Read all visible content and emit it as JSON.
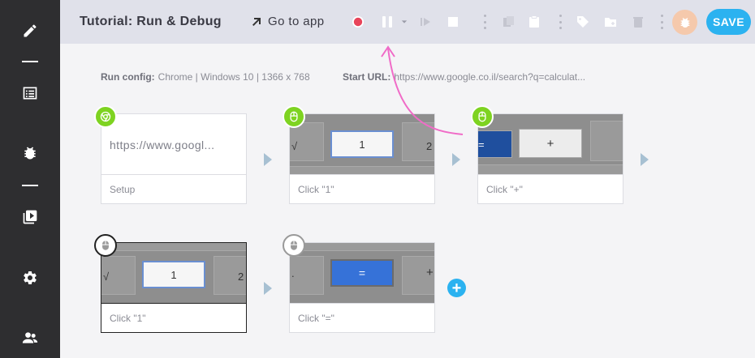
{
  "header": {
    "title": "Tutorial: Run & Debug",
    "goto_label": "Go to app",
    "save_label": "SAVE"
  },
  "config": {
    "run_label": "Run config:",
    "run_value": "Chrome | Windows 10 | 1366 x 768",
    "url_label": "Start URL:",
    "url_value": "https://www.google.co.il/search?q=calculat..."
  },
  "steps": [
    {
      "label": "Setup",
      "url": "https://www.googl..."
    },
    {
      "label": "Click \"1\"",
      "key": "1",
      "side_left": "√",
      "side_right": "2"
    },
    {
      "label": "Click \"+\"",
      "key": "+",
      "side_left": "="
    },
    {
      "label": "Click \"1\"",
      "key": "1",
      "side_left": "√",
      "side_right": "2"
    },
    {
      "label": "Click \"=\"",
      "key": "=",
      "side_left": ".",
      "side_right": "+"
    }
  ],
  "add_label": "+",
  "colors": {
    "accent": "#2bb2f0",
    "record": "#e8445a",
    "badge_green": "#7ed321",
    "annotation": "#f06bc7"
  }
}
